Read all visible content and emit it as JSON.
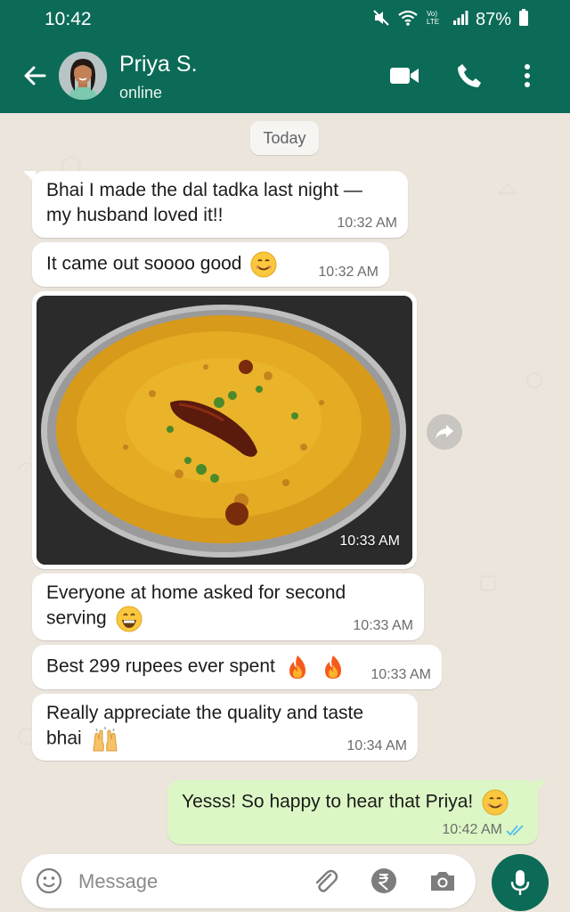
{
  "status_bar": {
    "time": "10:42",
    "battery": "87%",
    "network": "Vo) LTE"
  },
  "header": {
    "contact_name": "Priya S.",
    "contact_status": "online",
    "icons": [
      "back-arrow-icon",
      "video-call-icon",
      "voice-call-icon",
      "more-options-icon"
    ]
  },
  "chat": {
    "date_label": "Today",
    "messages": [
      {
        "type": "text",
        "direction": "in",
        "lines": [
          "Bhai I made the dal tadka last night —",
          "my husband loved it!!"
        ],
        "time": "10:32 AM"
      },
      {
        "type": "text",
        "direction": "in",
        "lines": [
          "It came out soooo good"
        ],
        "emoji": "smiling-face",
        "time": "10:32 AM"
      },
      {
        "type": "image",
        "direction": "in",
        "image": "dal-tadka-photo",
        "time": "10:33 AM"
      },
      {
        "type": "text",
        "direction": "in",
        "lines": [
          "Everyone at home asked for second",
          "serving"
        ],
        "emoji": "grinning-face",
        "time": "10:33 AM"
      },
      {
        "type": "text",
        "direction": "in",
        "lines": [
          "Best 299 rupees ever spent"
        ],
        "emoji": "fire-fire",
        "time": "10:33 AM"
      },
      {
        "type": "text",
        "direction": "in",
        "lines": [
          "Really appreciate the quality and taste",
          "bhai"
        ],
        "emoji": "raising-hands",
        "time": "10:34 AM"
      },
      {
        "type": "text",
        "direction": "out",
        "lines": [
          "Yesss! So happy to hear that Priya!"
        ],
        "emoji": "smiling-face",
        "time": "10:42 AM",
        "read_receipt": "double-check-blue"
      }
    ]
  },
  "composer": {
    "placeholder": "Message",
    "icons": [
      "emoji-icon",
      "attach-icon",
      "rupee-payment-icon",
      "camera-icon",
      "mic-icon"
    ]
  },
  "colors": {
    "header_green": "#0b6b56",
    "chat_background": "#ebe5dc",
    "incoming_bubble": "#ffffff",
    "outgoing_bubble": "#dcf7c5",
    "read_tick_blue": "#53bdeb"
  }
}
